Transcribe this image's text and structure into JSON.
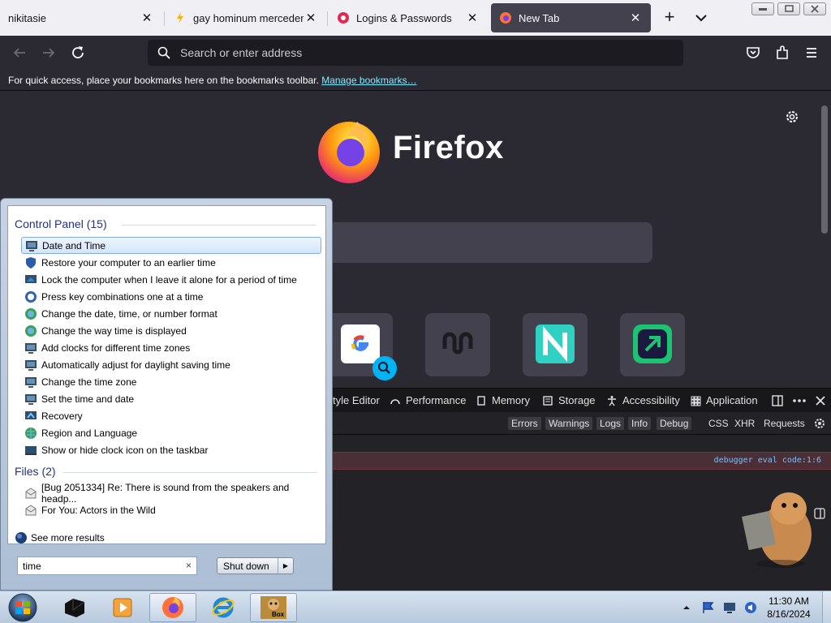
{
  "browser": {
    "tabs": [
      {
        "title": "nikitasie",
        "active": false
      },
      {
        "title": "gay hominum mercedem",
        "active": false
      },
      {
        "title": "Logins & Passwords",
        "active": false
      },
      {
        "title": "New Tab",
        "active": true
      }
    ],
    "tab_close_glyph": "✕",
    "new_tab_glyph": "+",
    "address_placeholder": "Search or enter address",
    "bookmarks_bar_text": "For quick access, place your bookmarks here on the bookmarks toolbar.",
    "bookmarks_bar_link": "Manage bookmarks…",
    "brand_name": "Firefox"
  },
  "devtools": {
    "tabs": [
      "tyle Editor",
      "Performance",
      "Memory",
      "Storage",
      "Accessibility",
      "Application"
    ],
    "filters": [
      "Errors",
      "Warnings",
      "Logs",
      "Info",
      "Debug"
    ],
    "request_filters": [
      "CSS",
      "XHR",
      "Requests"
    ],
    "error_location": "debugger eval code:1:6"
  },
  "start_menu": {
    "control_panel_heading": "Control Panel (15)",
    "control_panel_items": [
      "Date and Time",
      "Restore your computer to an earlier time",
      "Lock the computer when I leave it alone for a period of time",
      "Press key combinations one at a time",
      "Change the date, time, or number format",
      "Change the way time is displayed",
      "Add clocks for different time zones",
      "Automatically adjust for daylight saving time",
      "Change the time zone",
      "Set the time and date",
      "Recovery",
      "Region and Language",
      "Show or hide clock icon on the taskbar"
    ],
    "files_heading": "Files (2)",
    "file_items": [
      "[Bug 2051334] Re: There is sound from the speakers and headp...",
      "For You: Actors in the Wild"
    ],
    "see_more": "See more results",
    "search_value": "time",
    "clear_glyph": "×",
    "shutdown_label": "Shut down"
  },
  "taskbar": {
    "time": "11:30 AM",
    "date": "8/16/2024",
    "box_label": "Box"
  },
  "colors": {
    "firefox_dark": "#2b2a33",
    "accent_link": "#80ebff",
    "start_heading": "#1e3287",
    "devtools_error_bg": "#4b2f36"
  }
}
